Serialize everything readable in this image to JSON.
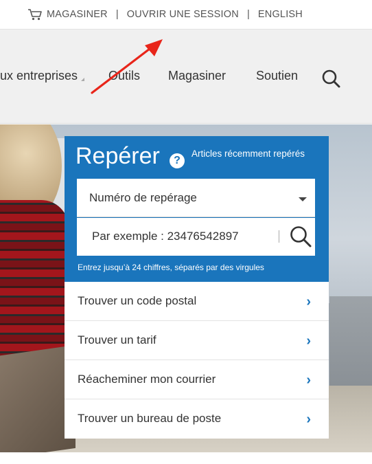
{
  "utility_bar": {
    "shop_label": "MAGASINER",
    "signin_label": "OUVRIR UNE SESSION",
    "language_label": "ENGLISH",
    "separator": "|"
  },
  "main_nav": {
    "items": [
      {
        "label": "ux entreprises"
      },
      {
        "label": "Outils"
      },
      {
        "label": "Magasiner"
      },
      {
        "label": "Soutien"
      }
    ],
    "search_icon": "search-icon"
  },
  "track_panel": {
    "title": "Repérer",
    "help_symbol": "?",
    "recent_link": "Articles récemment repérés",
    "type_select": {
      "selected": "Numéro de repérage"
    },
    "tracking_input": {
      "placeholder": "Par exemple : 23476542897"
    },
    "hint": "Entrez jusqu’à 24 chiffres, séparés par des virgules",
    "quick_links": [
      {
        "label": "Trouver un code postal"
      },
      {
        "label": "Trouver un tarif"
      },
      {
        "label": "Réacheminer mon courrier"
      },
      {
        "label": "Trouver un bureau de poste"
      }
    ],
    "chevron": "›"
  },
  "colors": {
    "brand_blue": "#1a75bc",
    "annotation_red": "#e8251a",
    "nav_bg": "#f0f0f0"
  }
}
